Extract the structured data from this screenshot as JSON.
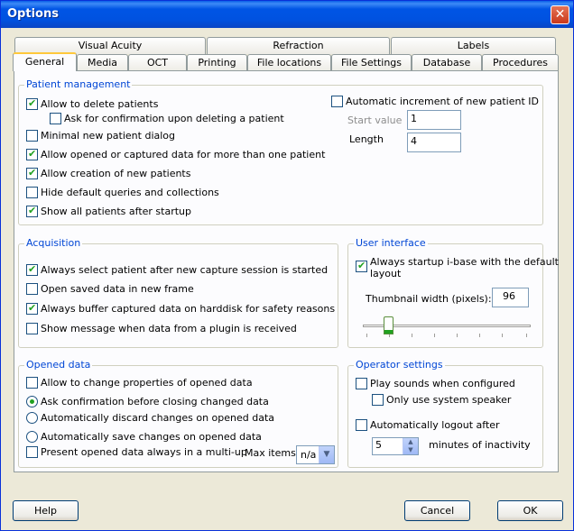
{
  "window": {
    "title": "Options",
    "close_label": "✕"
  },
  "tabs_row1": [
    "Visual Acuity",
    "Refraction",
    "Labels"
  ],
  "tabs_row2": [
    "General",
    "Media",
    "OCT",
    "Printing",
    "File locations",
    "File Settings",
    "Database",
    "Procedures"
  ],
  "patient_management": {
    "title": "Patient management",
    "allow_delete": "Allow to delete patients",
    "ask_confirm_delete": "Ask for confirmation upon deleting a patient",
    "minimal_dialog": "Minimal new patient dialog",
    "allow_opened_multi": "Allow opened or captured data for more than one patient",
    "allow_creation": "Allow creation of new patients",
    "hide_default": "Hide default queries and collections",
    "show_all": "Show all patients after startup",
    "auto_increment": "Automatic increment of new patient ID",
    "start_value_label": "Start value",
    "start_value": "1",
    "length_label": "Length",
    "length_value": "4"
  },
  "acquisition": {
    "title": "Acquisition",
    "always_select": "Always select patient after new capture session is started",
    "open_saved": "Open saved data in new frame",
    "always_buffer": "Always buffer captured data on harddisk for safety reasons",
    "show_message": "Show message when data from a plugin is received"
  },
  "user_interface": {
    "title": "User interface",
    "always_startup_1": "Always startup i-base with the default",
    "always_startup_2": "layout",
    "thumb_width_label": "Thumbnail width (pixels):",
    "thumb_width_value": "96",
    "slider_level": 0.15
  },
  "opened_data": {
    "title": "Opened data",
    "allow_change": "Allow to change properties of opened data",
    "ask_confirm": "Ask confirmation before closing changed data",
    "auto_discard": "Automatically discard changes on opened data",
    "auto_save": "Automatically save changes on opened data",
    "present_multi": "Present opened data always in a multi-up",
    "max_items_label": "Max items",
    "max_items_value": "n/a"
  },
  "operator_settings": {
    "title": "Operator settings",
    "play_sounds": "Play sounds when configured",
    "only_system_speaker": "Only use system speaker",
    "auto_logout": "Automatically logout after",
    "logout_minutes": "5",
    "minutes_label": "minutes of inactivity"
  },
  "buttons": {
    "help": "Help",
    "cancel": "Cancel",
    "ok": "OK"
  }
}
